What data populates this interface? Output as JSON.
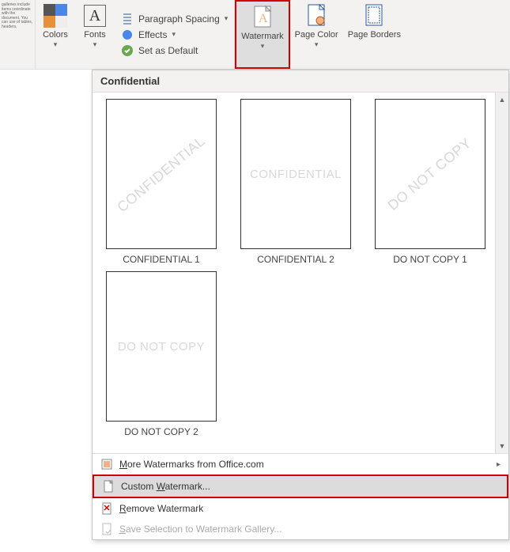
{
  "ribbon": {
    "docSnippet": "galleries include items coordinate with the document. You can use of tables, headers,",
    "colors": "Colors",
    "fonts": "Fonts",
    "paragraphSpacing": "Paragraph Spacing",
    "effects": "Effects",
    "setDefault": "Set as Default",
    "watermark": "Watermark",
    "pageColor": "Page Color",
    "pageBorders": "Page Borders"
  },
  "dropdown": {
    "header": "Confidential",
    "thumbs": [
      {
        "wm": "CONFIDENTIAL",
        "size": "18px",
        "label": "CONFIDENTIAL 1"
      },
      {
        "wm": "CONFIDENTIAL",
        "size": "15px",
        "label": "CONFIDENTIAL 2"
      },
      {
        "wm": "DO NOT COPY",
        "size": "18px",
        "label": "DO NOT COPY 1"
      },
      {
        "wm": "DO NOT COPY",
        "size": "15px",
        "label": "DO NOT COPY 2"
      }
    ],
    "menu": {
      "more": "More Watermarks from Office.com",
      "customPre": "Custom ",
      "customU": "W",
      "customPost": "atermark...",
      "removeU": "R",
      "removePost": "emove Watermark",
      "saveU": "S",
      "savePost": "ave Selection to Watermark Gallery..."
    }
  }
}
